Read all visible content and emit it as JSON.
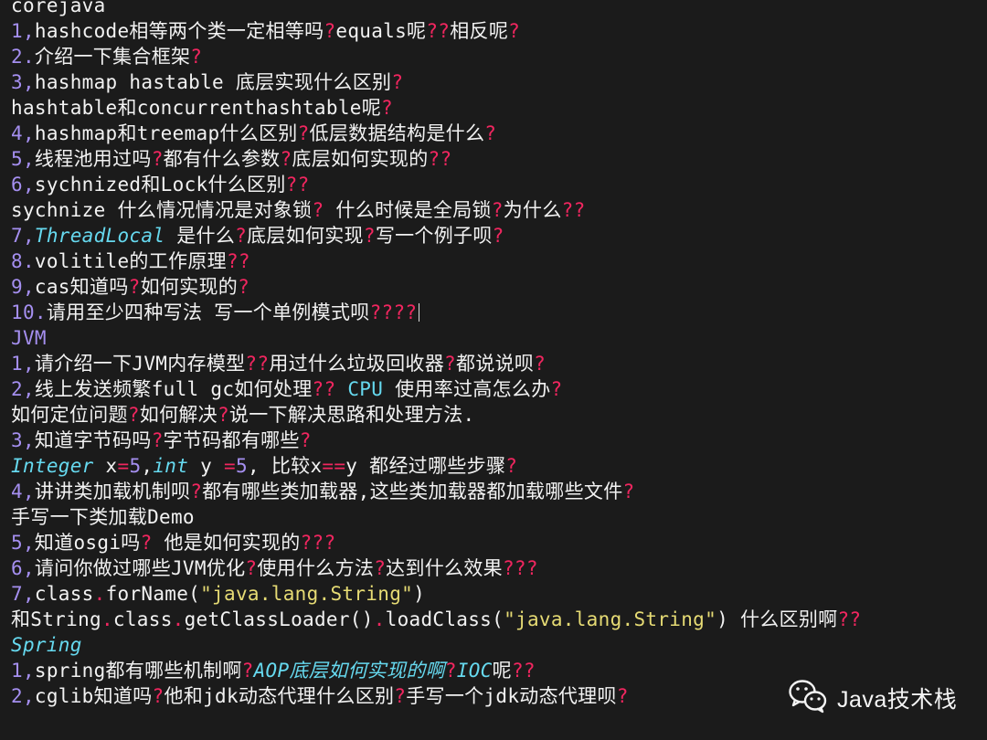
{
  "lines": [
    [
      [
        "corejava",
        "txt"
      ]
    ],
    [
      [
        "1,",
        "num"
      ],
      [
        "hashcode相等两个类一定相等吗",
        "txt"
      ],
      [
        "?",
        "q"
      ],
      [
        "equals呢",
        "txt"
      ],
      [
        "??",
        "q"
      ],
      [
        "相反呢",
        "txt"
      ],
      [
        "?",
        "q"
      ]
    ],
    [
      [
        "2.",
        "num"
      ],
      [
        "介绍一下集合框架",
        "txt"
      ],
      [
        "?",
        "q"
      ]
    ],
    [
      [
        "3,",
        "num"
      ],
      [
        "hashmap hastable 底层实现什么区别",
        "txt"
      ],
      [
        "?",
        "q"
      ]
    ],
    [
      [
        "hashtable和concurrenthashtable呢",
        "txt"
      ],
      [
        "?",
        "q"
      ]
    ],
    [
      [
        "4,",
        "num"
      ],
      [
        "hashmap和treemap什么区别",
        "txt"
      ],
      [
        "?",
        "q"
      ],
      [
        "低层数据结构是什么",
        "txt"
      ],
      [
        "?",
        "q"
      ]
    ],
    [
      [
        "5,",
        "num"
      ],
      [
        "线程池用过吗",
        "txt"
      ],
      [
        "?",
        "q"
      ],
      [
        "都有什么参数",
        "txt"
      ],
      [
        "?",
        "q"
      ],
      [
        "底层如何实现的",
        "txt"
      ],
      [
        "??",
        "q"
      ]
    ],
    [
      [
        "6,",
        "num"
      ],
      [
        "sychnized和Lock什么区别",
        "txt"
      ],
      [
        "??",
        "q"
      ]
    ],
    [
      [
        "sychnize 什么情况情况是对象锁",
        "txt"
      ],
      [
        "?",
        "q"
      ],
      [
        " 什么时候是全局锁",
        "txt"
      ],
      [
        "?",
        "q"
      ],
      [
        "为什么",
        "txt"
      ],
      [
        "??",
        "q"
      ]
    ],
    [
      [
        "7,",
        "num"
      ],
      [
        "ThreadLocal",
        "kw"
      ],
      [
        " 是什么",
        "txt"
      ],
      [
        "?",
        "q"
      ],
      [
        "底层如何实现",
        "txt"
      ],
      [
        "?",
        "q"
      ],
      [
        "写一个例子呗",
        "txt"
      ],
      [
        "?",
        "q"
      ]
    ],
    [
      [
        "8.",
        "num"
      ],
      [
        "volitile的工作原理",
        "txt"
      ],
      [
        "??",
        "q"
      ]
    ],
    [
      [
        "9,",
        "num"
      ],
      [
        "cas知道吗",
        "txt"
      ],
      [
        "?",
        "q"
      ],
      [
        "如何实现的",
        "txt"
      ],
      [
        "?",
        "q"
      ]
    ],
    [
      [
        "10.",
        "num"
      ],
      [
        "请用至少四种写法 写一个单例模式呗",
        "txt"
      ],
      [
        "????",
        "q"
      ]
    ],
    [
      [
        "JVM",
        "num"
      ]
    ],
    [
      [
        "1,",
        "num"
      ],
      [
        "请介绍一下JVM内存模型",
        "txt"
      ],
      [
        "??",
        "q"
      ],
      [
        "用过什么垃圾回收器",
        "txt"
      ],
      [
        "?",
        "q"
      ],
      [
        "都说说呗",
        "txt"
      ],
      [
        "?",
        "q"
      ]
    ],
    [
      [
        "2,",
        "num"
      ],
      [
        "线上发送频繁full gc如何处理",
        "txt"
      ],
      [
        "??",
        "q"
      ],
      [
        " CPU",
        "kwc"
      ],
      [
        " 使用率过高怎么办",
        "txt"
      ],
      [
        "?",
        "q"
      ]
    ],
    [
      [
        "如何定位问题",
        "txt"
      ],
      [
        "?",
        "q"
      ],
      [
        "如何解决",
        "txt"
      ],
      [
        "?",
        "q"
      ],
      [
        "说一下解决思路和处理方法.",
        "txt"
      ]
    ],
    [
      [
        "3,",
        "num"
      ],
      [
        "知道字节码吗",
        "txt"
      ],
      [
        "?",
        "q"
      ],
      [
        "字节码都有哪些",
        "txt"
      ],
      [
        "?",
        "q"
      ]
    ],
    [
      [
        "Integer",
        "kw"
      ],
      [
        " x",
        "txt"
      ],
      [
        "=",
        "op"
      ],
      [
        "5",
        "num"
      ],
      [
        ",",
        "txt"
      ],
      [
        "int",
        "kw"
      ],
      [
        " y ",
        "txt"
      ],
      [
        "=",
        "op"
      ],
      [
        "5",
        "num"
      ],
      [
        ", 比较x",
        "txt"
      ],
      [
        "==",
        "op"
      ],
      [
        "y 都经过哪些步骤",
        "txt"
      ],
      [
        "?",
        "q"
      ]
    ],
    [
      [
        "4,",
        "num"
      ],
      [
        "讲讲类加载机制呗",
        "txt"
      ],
      [
        "?",
        "q"
      ],
      [
        "都有哪些类加载器,这些类加载器都加载哪些文件",
        "txt"
      ],
      [
        "?",
        "q"
      ]
    ],
    [
      [
        "手写一下类加载Demo",
        "txt"
      ]
    ],
    [
      [
        "5,",
        "num"
      ],
      [
        "知道osgi吗",
        "txt"
      ],
      [
        "?",
        "q"
      ],
      [
        " 他是如何实现的",
        "txt"
      ],
      [
        "???",
        "q"
      ]
    ],
    [
      [
        "6,",
        "num"
      ],
      [
        "请问你做过哪些JVM优化",
        "txt"
      ],
      [
        "?",
        "q"
      ],
      [
        "使用什么方法",
        "txt"
      ],
      [
        "?",
        "q"
      ],
      [
        "达到什么效果",
        "txt"
      ],
      [
        "???",
        "q"
      ]
    ],
    [
      [
        "7,",
        "num"
      ],
      [
        "class",
        "txt"
      ],
      [
        ".",
        "op"
      ],
      [
        "forName(",
        "txt"
      ],
      [
        "\"java.lang.String\"",
        "str"
      ],
      [
        ")",
        "txt"
      ]
    ],
    [
      [
        "和String",
        "txt"
      ],
      [
        ".",
        "op"
      ],
      [
        "class",
        "txt"
      ],
      [
        ".",
        "op"
      ],
      [
        "getClassLoader()",
        "txt"
      ],
      [
        ".",
        "op"
      ],
      [
        "loadClass(",
        "txt"
      ],
      [
        "\"java.lang.String\"",
        "str"
      ],
      [
        ") 什么区别啊",
        "txt"
      ],
      [
        "??",
        "q"
      ]
    ],
    [
      [
        "Spring",
        "kw"
      ]
    ],
    [
      [
        "1,",
        "num"
      ],
      [
        "spring都有哪些机制啊",
        "txt"
      ],
      [
        "?",
        "q"
      ],
      [
        "AOP底层如何实现的啊",
        "kw"
      ],
      [
        "?",
        "q"
      ],
      [
        "IOC",
        "kw"
      ],
      [
        "呢",
        "txt"
      ],
      [
        "??",
        "q"
      ]
    ],
    [
      [
        "2,",
        "num"
      ],
      [
        "cglib知道吗",
        "txt"
      ],
      [
        "?",
        "q"
      ],
      [
        "他和jdk动态代理什么区别",
        "txt"
      ],
      [
        "?",
        "q"
      ],
      [
        "手写一个jdk动态代理呗",
        "txt"
      ],
      [
        "?",
        "q"
      ]
    ]
  ],
  "cursor_line": 12,
  "watermark": {
    "icon": "wechat-icon",
    "text": "Java技术栈"
  },
  "colors": {
    "background": "#1b1b1b",
    "text": "#f2f2f2",
    "number": "#a58ff0",
    "question_mark": "#f0265f",
    "keyword": "#66d9ef",
    "string": "#e6db74"
  }
}
